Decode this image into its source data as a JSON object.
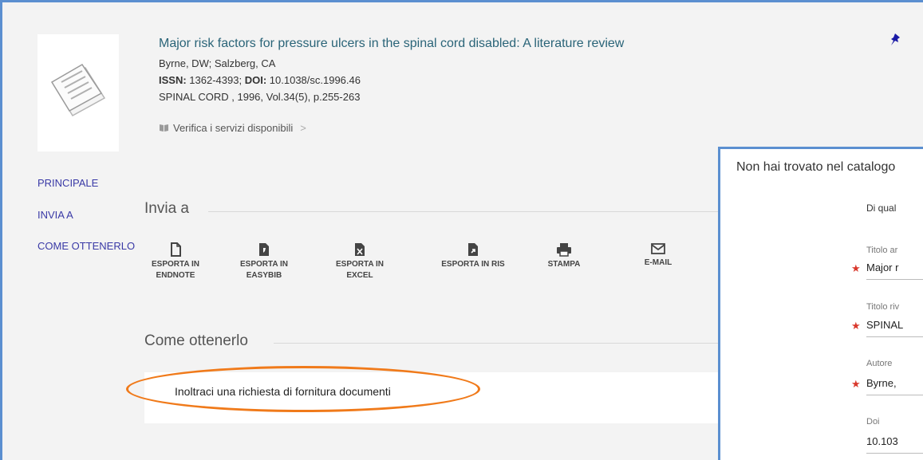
{
  "record": {
    "title": "Major risk factors for pressure ulcers in the spinal cord disabled: A literature review",
    "authors": "Byrne, DW; Salzberg, CA",
    "issn_label": "ISSN:",
    "issn_value": "1362-4393;",
    "doi_label": "DOI:",
    "doi_value": "10.1038/sc.1996.46",
    "source": "SPINAL CORD , 1996, Vol.34(5), p.255-263",
    "services_label": "Verifica i servizi disponibili",
    "services_chevron": ">"
  },
  "nav": {
    "items": [
      {
        "label": "PRINCIPALE"
      },
      {
        "label": "INVIA A"
      },
      {
        "label": "COME OTTENERLO"
      }
    ]
  },
  "send_to": {
    "title": "Invia a",
    "actions": [
      {
        "line1": "ESPORTA IN",
        "line2": "ENDNOTE",
        "icon": "file-outline-icon"
      },
      {
        "line1": "ESPORTA IN",
        "line2": "EASYBIB",
        "icon": "file-easybib-icon"
      },
      {
        "line1": "ESPORTA IN",
        "line2": "EXCEL",
        "icon": "file-excel-icon"
      },
      {
        "line1": "ESPORTA IN RIS",
        "line2": "",
        "icon": "file-ris-icon"
      },
      {
        "line1": "STAMPA",
        "line2": "",
        "icon": "printer-icon"
      },
      {
        "line1": "E-MAIL",
        "line2": "",
        "icon": "envelope-icon"
      }
    ]
  },
  "how_to_get": {
    "title": "Come ottenerlo",
    "request_link": "Inoltraci una richiesta di fornitura documenti"
  },
  "modal": {
    "title": "Non hai trovato nel catalogo",
    "question": "Di qual",
    "fields": [
      {
        "label": "Titolo ar",
        "value": "Major r",
        "required": true
      },
      {
        "label": "Titolo riv",
        "value": "SPINAL",
        "required": true
      },
      {
        "label": "Autore",
        "value": "Byrne,",
        "required": true
      },
      {
        "label": "Doi",
        "value": "10.103",
        "required": false
      }
    ]
  },
  "colors": {
    "frame_border": "#5b8fd0",
    "title_link": "#2a6478",
    "nav_link": "#3a3aa6",
    "highlight_ellipse": "#f07a1a",
    "required_star": "#d9382c"
  }
}
